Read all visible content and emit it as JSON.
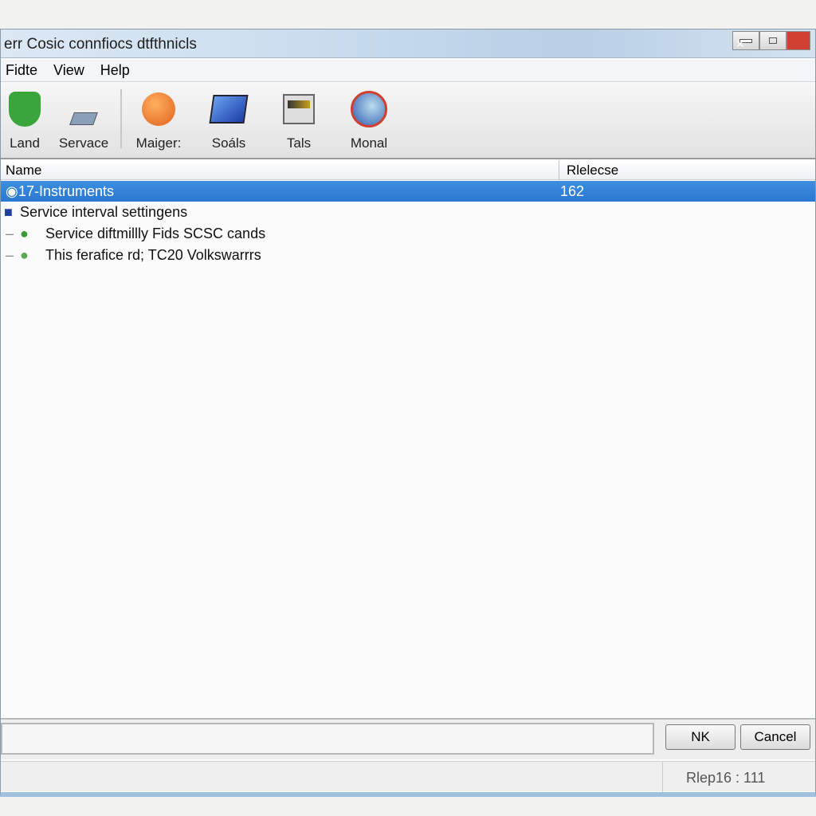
{
  "window": {
    "title": "err Cosic connfiocs dtfthnicls"
  },
  "menu": [
    "Fidte",
    "View",
    "Help"
  ],
  "toolbar": [
    {
      "label": "Land",
      "icon": "green-shield-icon"
    },
    {
      "label": "Servace",
      "icon": "probe-icon"
    },
    {
      "label": "Maiger:",
      "icon": "orange-orb-icon"
    },
    {
      "label": "Soáls",
      "icon": "monitor-icon"
    },
    {
      "label": "Tals",
      "icon": "meter-icon"
    },
    {
      "label": "Monal",
      "icon": "globe-icon"
    }
  ],
  "list": {
    "columns": [
      "Name",
      "Rlelecse"
    ],
    "rows": [
      {
        "name": "17-Instruments",
        "release": "162",
        "selected": true
      },
      {
        "name": "Service interval settingens"
      },
      {
        "name": "Service diftmillly Fids SCSC cands"
      },
      {
        "name": "This ferafice rd; TC20 Volkswarrrs"
      }
    ]
  },
  "buttons": {
    "ok": "NK",
    "cancel": "Cancel"
  },
  "status": "Rlep16 : 111",
  "colors": {
    "selection": "#3385dc",
    "titlebar": "#c9dcee"
  }
}
